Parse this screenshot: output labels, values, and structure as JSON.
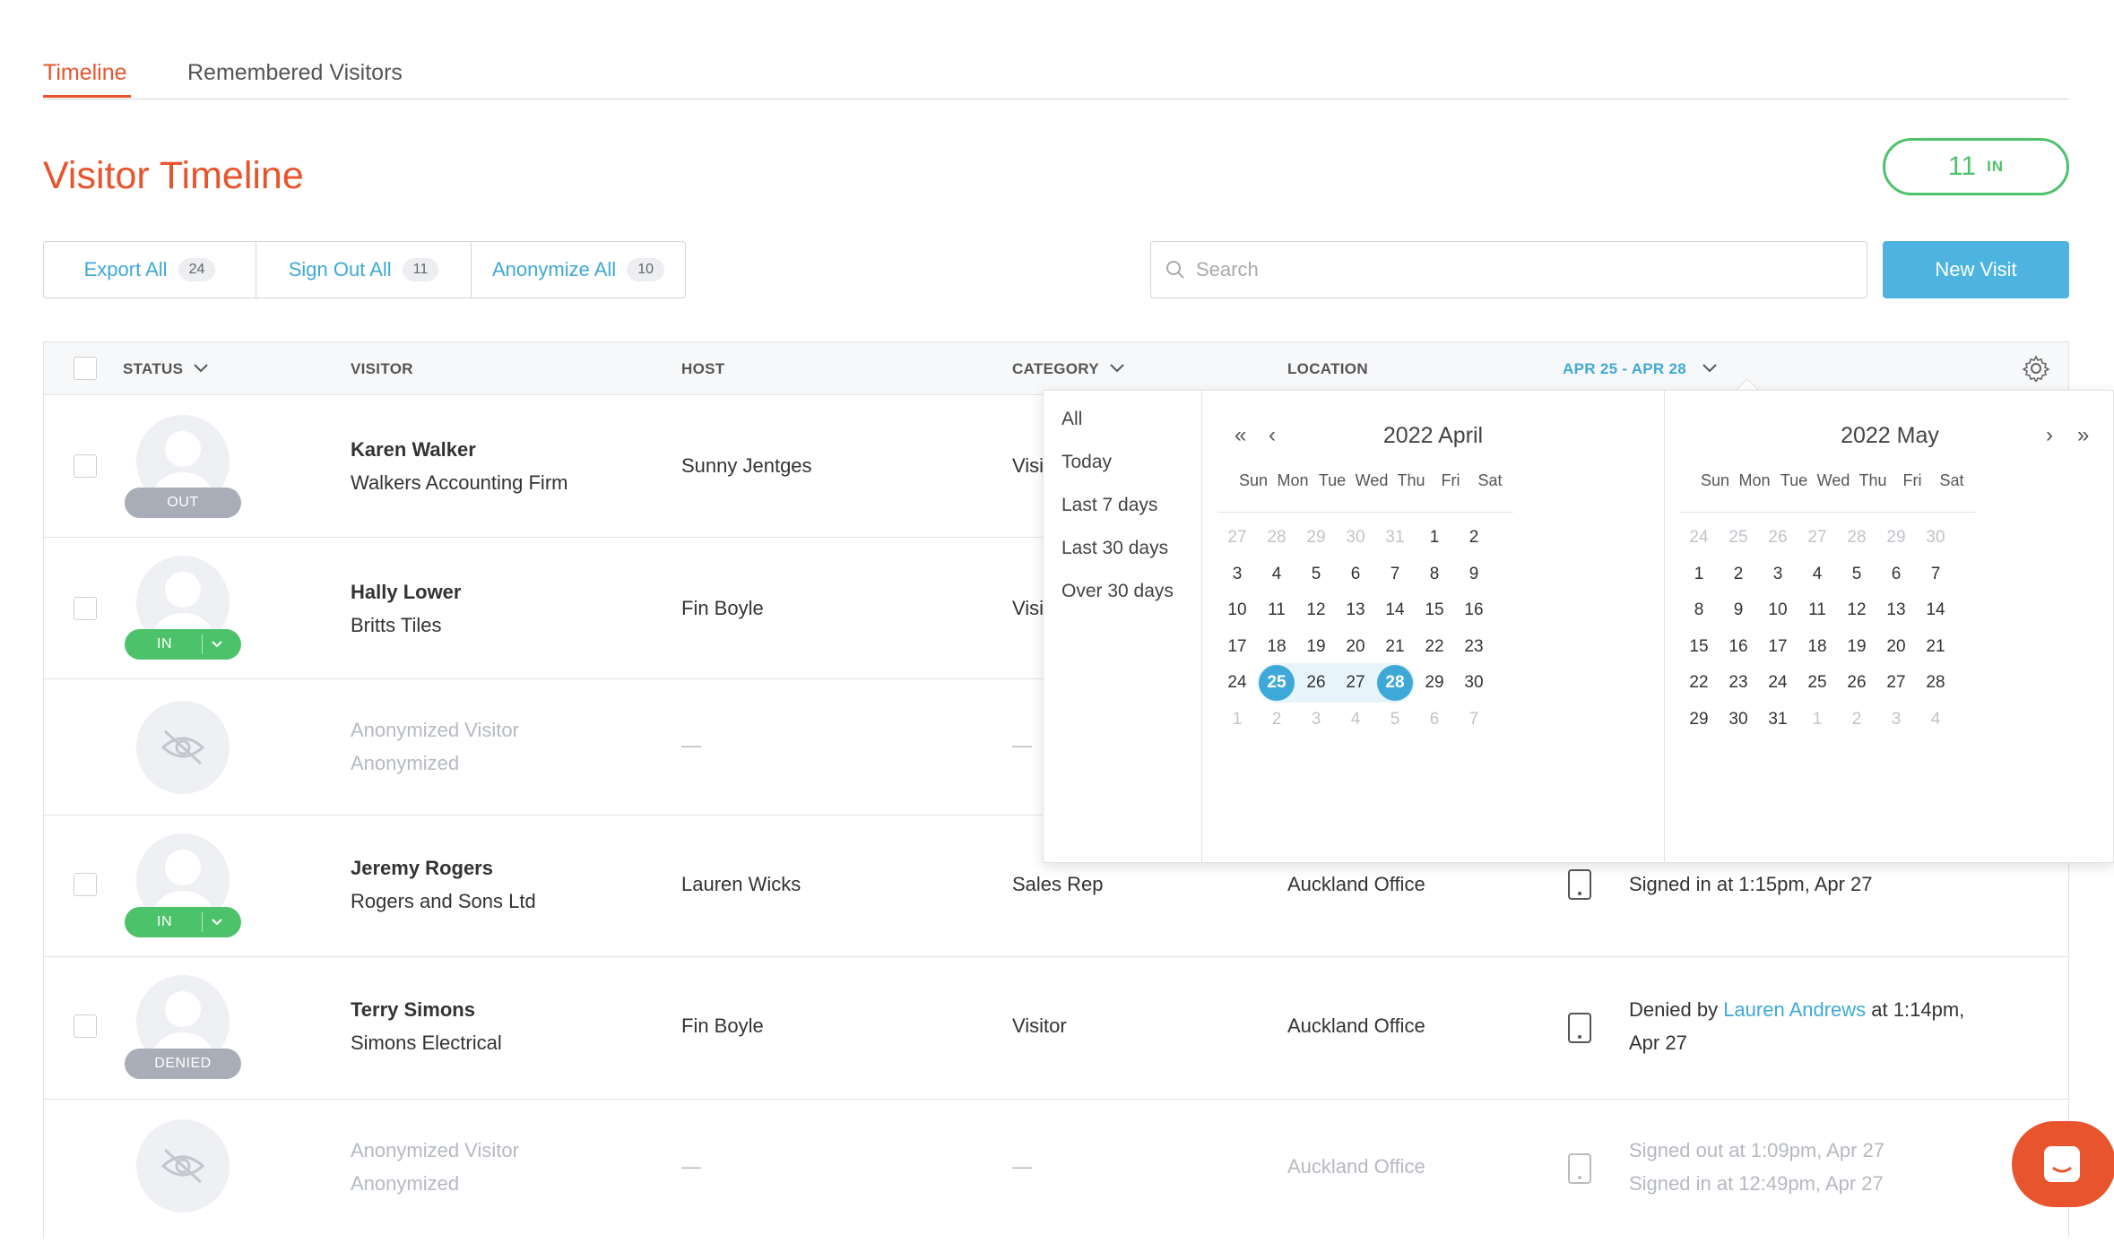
{
  "tabs": [
    {
      "label": "Timeline",
      "active": true
    },
    {
      "label": "Remembered Visitors",
      "active": false
    }
  ],
  "page": {
    "title": "Visitor Timeline",
    "in_count": "11",
    "in_label": "IN"
  },
  "actions": [
    {
      "label": "Export All",
      "count": "24"
    },
    {
      "label": "Sign Out All",
      "count": "11"
    },
    {
      "label": "Anonymize All",
      "count": "10"
    }
  ],
  "search": {
    "placeholder": "Search"
  },
  "new_visit_label": "New Visit",
  "table": {
    "headers": {
      "status": "STATUS",
      "visitor": "VISITOR",
      "host": "HOST",
      "category": "CATEGORY",
      "location": "LOCATION",
      "date_range": "APR 25 - APR 28"
    },
    "rows": [
      {
        "name": "Karen Walker",
        "company": "Walkers Accounting Firm",
        "host": "Sunny Jentges",
        "category": "Visi",
        "location": "",
        "status": "OUT",
        "activity": ""
      },
      {
        "name": "Hally Lower",
        "company": "Britts Tiles",
        "host": "Fin Boyle",
        "category": "Visi",
        "location": "",
        "status": "IN",
        "activity": ""
      },
      {
        "name": "Anonymized Visitor",
        "company": "Anonymized",
        "host": "—",
        "category": "—",
        "location": "",
        "status": "",
        "activity": ""
      },
      {
        "name": "Jeremy Rogers",
        "company": "Rogers and Sons Ltd",
        "host": "Lauren Wicks",
        "category": "Sales Rep",
        "location": "Auckland Office",
        "status": "IN",
        "activity": "Signed in at 1:15pm, Apr 27"
      },
      {
        "name": "Terry Simons",
        "company": "Simons Electrical",
        "host": "Fin Boyle",
        "category": "Visitor",
        "location": "Auckland Office",
        "status": "DENIED",
        "activity_prefix": "Denied by ",
        "activity_link": "Lauren Andrews",
        "activity_suffix": " at 1:14pm,",
        "activity_line2": "Apr 27"
      },
      {
        "name": "Anonymized Visitor",
        "company": "Anonymized",
        "host": "—",
        "category": "—",
        "location": "Auckland Office",
        "status": "",
        "activity": "Signed out at 1:09pm, Apr 27",
        "activity_line2": "Signed in at 12:49pm, Apr 27"
      }
    ]
  },
  "date_picker": {
    "presets": [
      "All",
      "Today",
      "Last 7 days",
      "Last 30 days",
      "Over 30 days"
    ],
    "weekdays": [
      "Sun",
      "Mon",
      "Tue",
      "Wed",
      "Thu",
      "Fri",
      "Sat"
    ],
    "months": [
      {
        "title": "2022 April",
        "weeks": [
          [
            "27",
            "28",
            "29",
            "30",
            "31",
            "1",
            "2"
          ],
          [
            "3",
            "4",
            "5",
            "6",
            "7",
            "8",
            "9"
          ],
          [
            "10",
            "11",
            "12",
            "13",
            "14",
            "15",
            "16"
          ],
          [
            "17",
            "18",
            "19",
            "20",
            "21",
            "22",
            "23"
          ],
          [
            "24",
            "25",
            "26",
            "27",
            "28",
            "29",
            "30"
          ],
          [
            "1",
            "2",
            "3",
            "4",
            "5",
            "6",
            "7"
          ]
        ]
      },
      {
        "title": "2022 May",
        "weeks": [
          [
            "24",
            "25",
            "26",
            "27",
            "28",
            "29",
            "30"
          ],
          [
            "1",
            "2",
            "3",
            "4",
            "5",
            "6",
            "7"
          ],
          [
            "8",
            "9",
            "10",
            "11",
            "12",
            "13",
            "14"
          ],
          [
            "15",
            "16",
            "17",
            "18",
            "19",
            "20",
            "21"
          ],
          [
            "22",
            "23",
            "24",
            "25",
            "26",
            "27",
            "28"
          ],
          [
            "29",
            "30",
            "31",
            "1",
            "2",
            "3",
            "4"
          ]
        ]
      }
    ],
    "range_start": "25",
    "range_end": "28",
    "nav": {
      "prev_year": "«",
      "prev_month": "‹",
      "next_month": "›",
      "next_year": "»"
    }
  },
  "colors": {
    "accent": "#e8542d",
    "link": "#3ea9d8",
    "in": "#4cc36a",
    "muted": "#a8adb7"
  }
}
